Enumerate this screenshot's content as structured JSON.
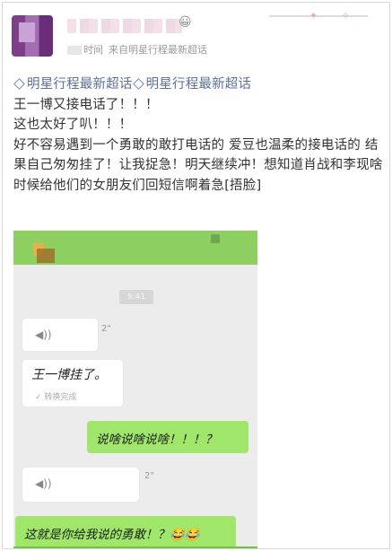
{
  "post": {
    "meta_time": "时间",
    "meta_source": "来自明星行程最新超话",
    "user_emoji": "😀",
    "tags": "明星行程最新超话",
    "lines": [
      "王一博又接电话了！！！",
      "这也太好了叭！！！",
      "好不容易遇到一个勇敢的敢打电话的 爱豆也温柔的接电话的  结果自己匆匆挂了！让我捉急！明天继续冲！想知道肖战和李现啥时候给他们的女朋友们回短信啊着急[捂脸]"
    ]
  },
  "chat": {
    "time_pill": "9:41",
    "voice1_duration": "2\"",
    "voice2_duration": "2\"",
    "msg1": "王一博挂了。",
    "msg1_sub": "转换完成",
    "green1": "说啥说啥说啥！！！？",
    "green2": "这就是你给我说的勇敢！？😂😂"
  },
  "icons": {
    "tag": "diamond-icon",
    "voice": "voice-wave-icon"
  },
  "colors": {
    "wechat_green": "#9fe66a",
    "tag_blue": "#5b6f9c"
  }
}
